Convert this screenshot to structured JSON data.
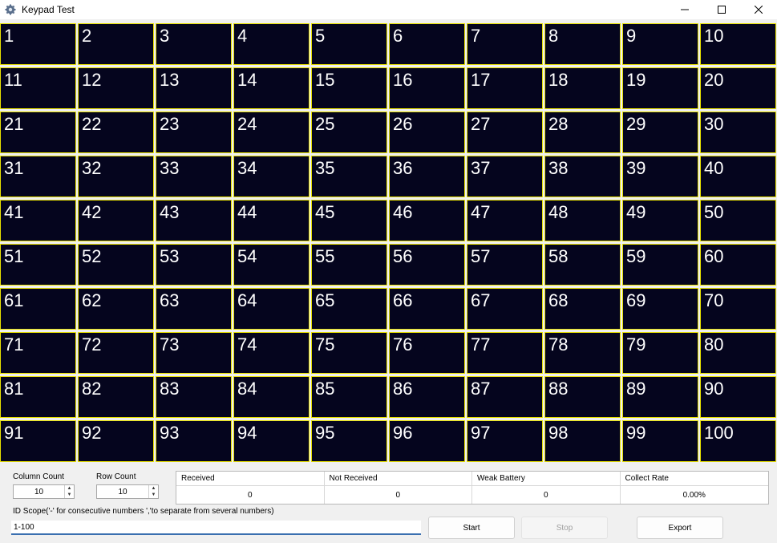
{
  "window": {
    "title": "Keypad Test",
    "icon": "gear-icon"
  },
  "colors": {
    "cell_background": "#05051e",
    "cell_border": "#e7e000",
    "cell_text": "#ffffff"
  },
  "keypad_cells": [
    "1",
    "2",
    "3",
    "4",
    "5",
    "6",
    "7",
    "8",
    "9",
    "10",
    "11",
    "12",
    "13",
    "14",
    "15",
    "16",
    "17",
    "18",
    "19",
    "20",
    "21",
    "22",
    "23",
    "24",
    "25",
    "26",
    "27",
    "28",
    "29",
    "30",
    "31",
    "32",
    "33",
    "34",
    "35",
    "36",
    "37",
    "38",
    "39",
    "40",
    "41",
    "42",
    "43",
    "44",
    "45",
    "46",
    "47",
    "48",
    "49",
    "50",
    "51",
    "52",
    "53",
    "54",
    "55",
    "56",
    "57",
    "58",
    "59",
    "60",
    "61",
    "62",
    "63",
    "64",
    "65",
    "66",
    "67",
    "68",
    "69",
    "70",
    "71",
    "72",
    "73",
    "74",
    "75",
    "76",
    "77",
    "78",
    "79",
    "80",
    "81",
    "82",
    "83",
    "84",
    "85",
    "86",
    "87",
    "88",
    "89",
    "90",
    "91",
    "92",
    "93",
    "94",
    "95",
    "96",
    "97",
    "98",
    "99",
    "100"
  ],
  "controls": {
    "column_count_label": "Column Count",
    "column_count_value": "10",
    "row_count_label": "Row Count",
    "row_count_value": "10",
    "id_scope_label": "ID Scope('-' for consecutive numbers ','to separate from several numbers)",
    "id_scope_value": "1-100",
    "start_label": "Start",
    "stop_label": "Stop",
    "export_label": "Export"
  },
  "stats": {
    "headers": [
      "Received",
      "Not Received",
      "Weak Battery",
      "Collect Rate"
    ],
    "values": [
      "0",
      "0",
      "0",
      "0.00%"
    ]
  }
}
